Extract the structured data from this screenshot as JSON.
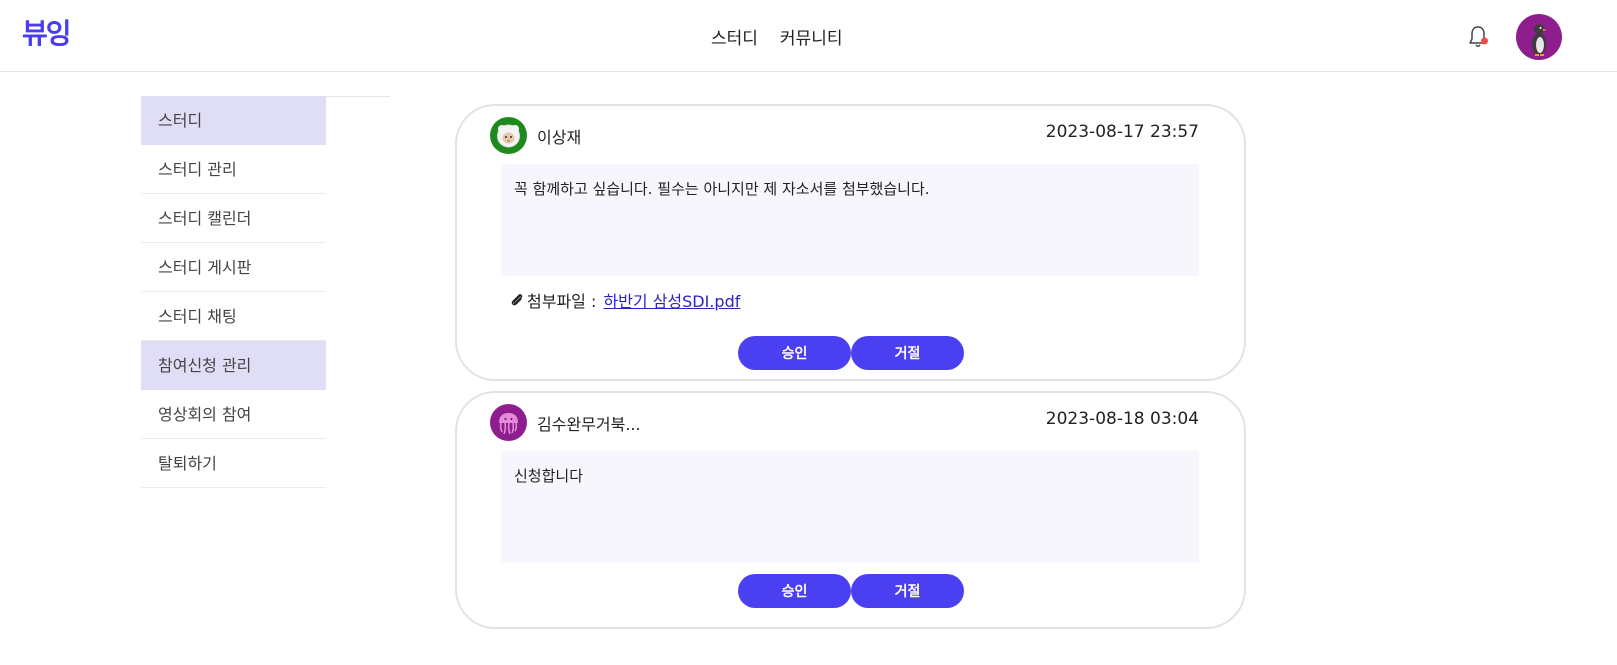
{
  "header": {
    "logo": "뷰잉",
    "nav": [
      "스터디",
      "커뮤니티"
    ],
    "colors": {
      "brand": "#4a3df0",
      "avatar_bg": "#8e1e8e",
      "bell_dot": "#ef4b4b"
    }
  },
  "sidebar": {
    "items": [
      {
        "label": "스터디",
        "active": true
      },
      {
        "label": "스터디 관리",
        "active": false
      },
      {
        "label": "스터디 캘린더",
        "active": false
      },
      {
        "label": "스터디 게시판",
        "active": false
      },
      {
        "label": "스터디 채팅",
        "active": false
      },
      {
        "label": "참여신청 관리",
        "active": true
      },
      {
        "label": "영상회의 참여",
        "active": false
      },
      {
        "label": "탈퇴하기",
        "active": false
      }
    ]
  },
  "applications": [
    {
      "name": "이상재",
      "date": "2023-08-17 23:57",
      "message": "꼭 함께하고 싶습니다. 필수는 아니지만 제 자소서를 첨부했습니다.",
      "attachment_label": "첨부파일 : ",
      "attachment_file": "하반기 삼성SDI.pdf",
      "approve_label": "승인",
      "reject_label": "거절",
      "avatar_color": "#1e8a1e"
    },
    {
      "name": "김수완무거북...",
      "date": "2023-08-18 03:04",
      "message": "신청합니다",
      "approve_label": "승인",
      "reject_label": "거절",
      "avatar_color": "#8e1e8e"
    }
  ]
}
